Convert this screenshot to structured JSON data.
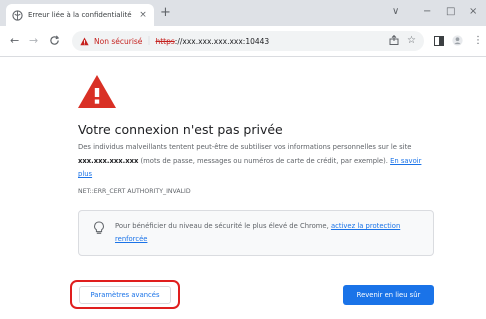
{
  "tab": {
    "title": "Erreur liée à la confidentialité",
    "close_icon": "close-icon",
    "new_tab_label": "+"
  },
  "window_controls": {
    "tabsearch": "∨",
    "minimize": "−",
    "maximize": "□",
    "close": "×"
  },
  "nav": {
    "back": "←",
    "forward": "→",
    "reload": "C"
  },
  "omnibox": {
    "security_label": "Non sécurisé",
    "url_scheme": "https",
    "url_rest": "://xxx.xxx.xxx.xxx:10443",
    "share_icon": "share-icon",
    "bookmark_icon": "star-icon"
  },
  "toolbar_right": {
    "sidepanel_icon": "side-panel-icon",
    "profile_icon": "profile-icon",
    "menu_icon": "⋮"
  },
  "page": {
    "headline": "Votre connexion n'est pas privée",
    "para_part1": "Des individus malveillants tentent peut-être de subtiliser vos informations personnelles sur le site ",
    "host": "xxx.xxx.xxx.xxx",
    "para_part2": " (mots de passe, messages ou numéros de carte de crédit, par exemple). ",
    "learn_more": "En savoir plus",
    "error_code": "NET::ERR_CERT AUTHORITY_INVALID",
    "enhanced_text": "Pour bénéficier du niveau de sécurité le plus élevé de Chrome, ",
    "enhanced_link": "activez la protection renforcée",
    "advanced_button": "Paramètres avancés",
    "back_button": "Revenir en lieu sûr"
  },
  "colors": {
    "warning_red": "#d93025",
    "link_blue": "#1a73e8",
    "highlight_red": "#e01e1e"
  }
}
